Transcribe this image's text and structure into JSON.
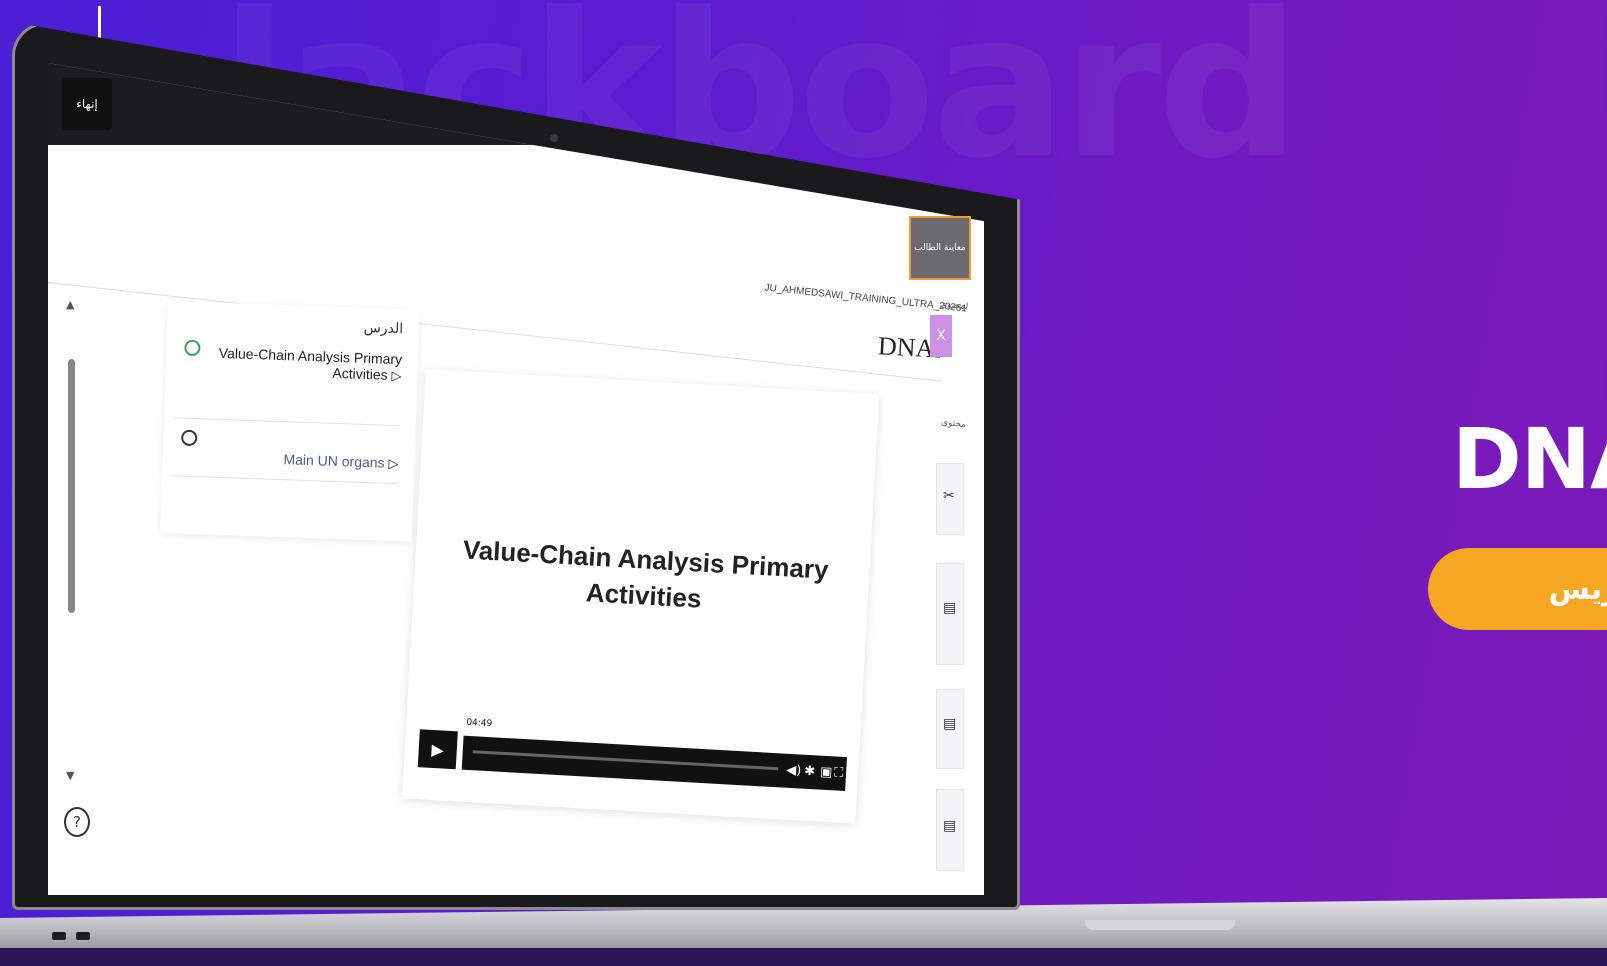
{
  "promo": {
    "title": "DNA",
    "pill_text": "تدريس"
  },
  "topbar": {
    "end_button_label": "إنهاء"
  },
  "course": {
    "code": "JU_AHMEDSAWI_TRAINING_ULTRA_20261",
    "title": "DNAr",
    "student_preview_label": "معاينة الطالب",
    "close_label": "X",
    "side_content_label_1": "لمحتوى",
    "side_content_label_2": "محتوى"
  },
  "outline": {
    "heading": "الدرس",
    "items": [
      {
        "label": "Value-Chain Analysis Primary Activities",
        "status": "in-progress"
      },
      {
        "label": "Main UN organs",
        "status": "not-started"
      }
    ]
  },
  "slide": {
    "title_line1": "Value-Chain Analysis Primary",
    "title_line2": "Activities"
  },
  "player": {
    "duration": "04:49",
    "progress": 0
  },
  "colors": {
    "accent_orange": "#f5a623",
    "preview_border": "#f39a3d",
    "close_purple": "#d08fe6",
    "bg_purple": "#5a1cd0"
  }
}
